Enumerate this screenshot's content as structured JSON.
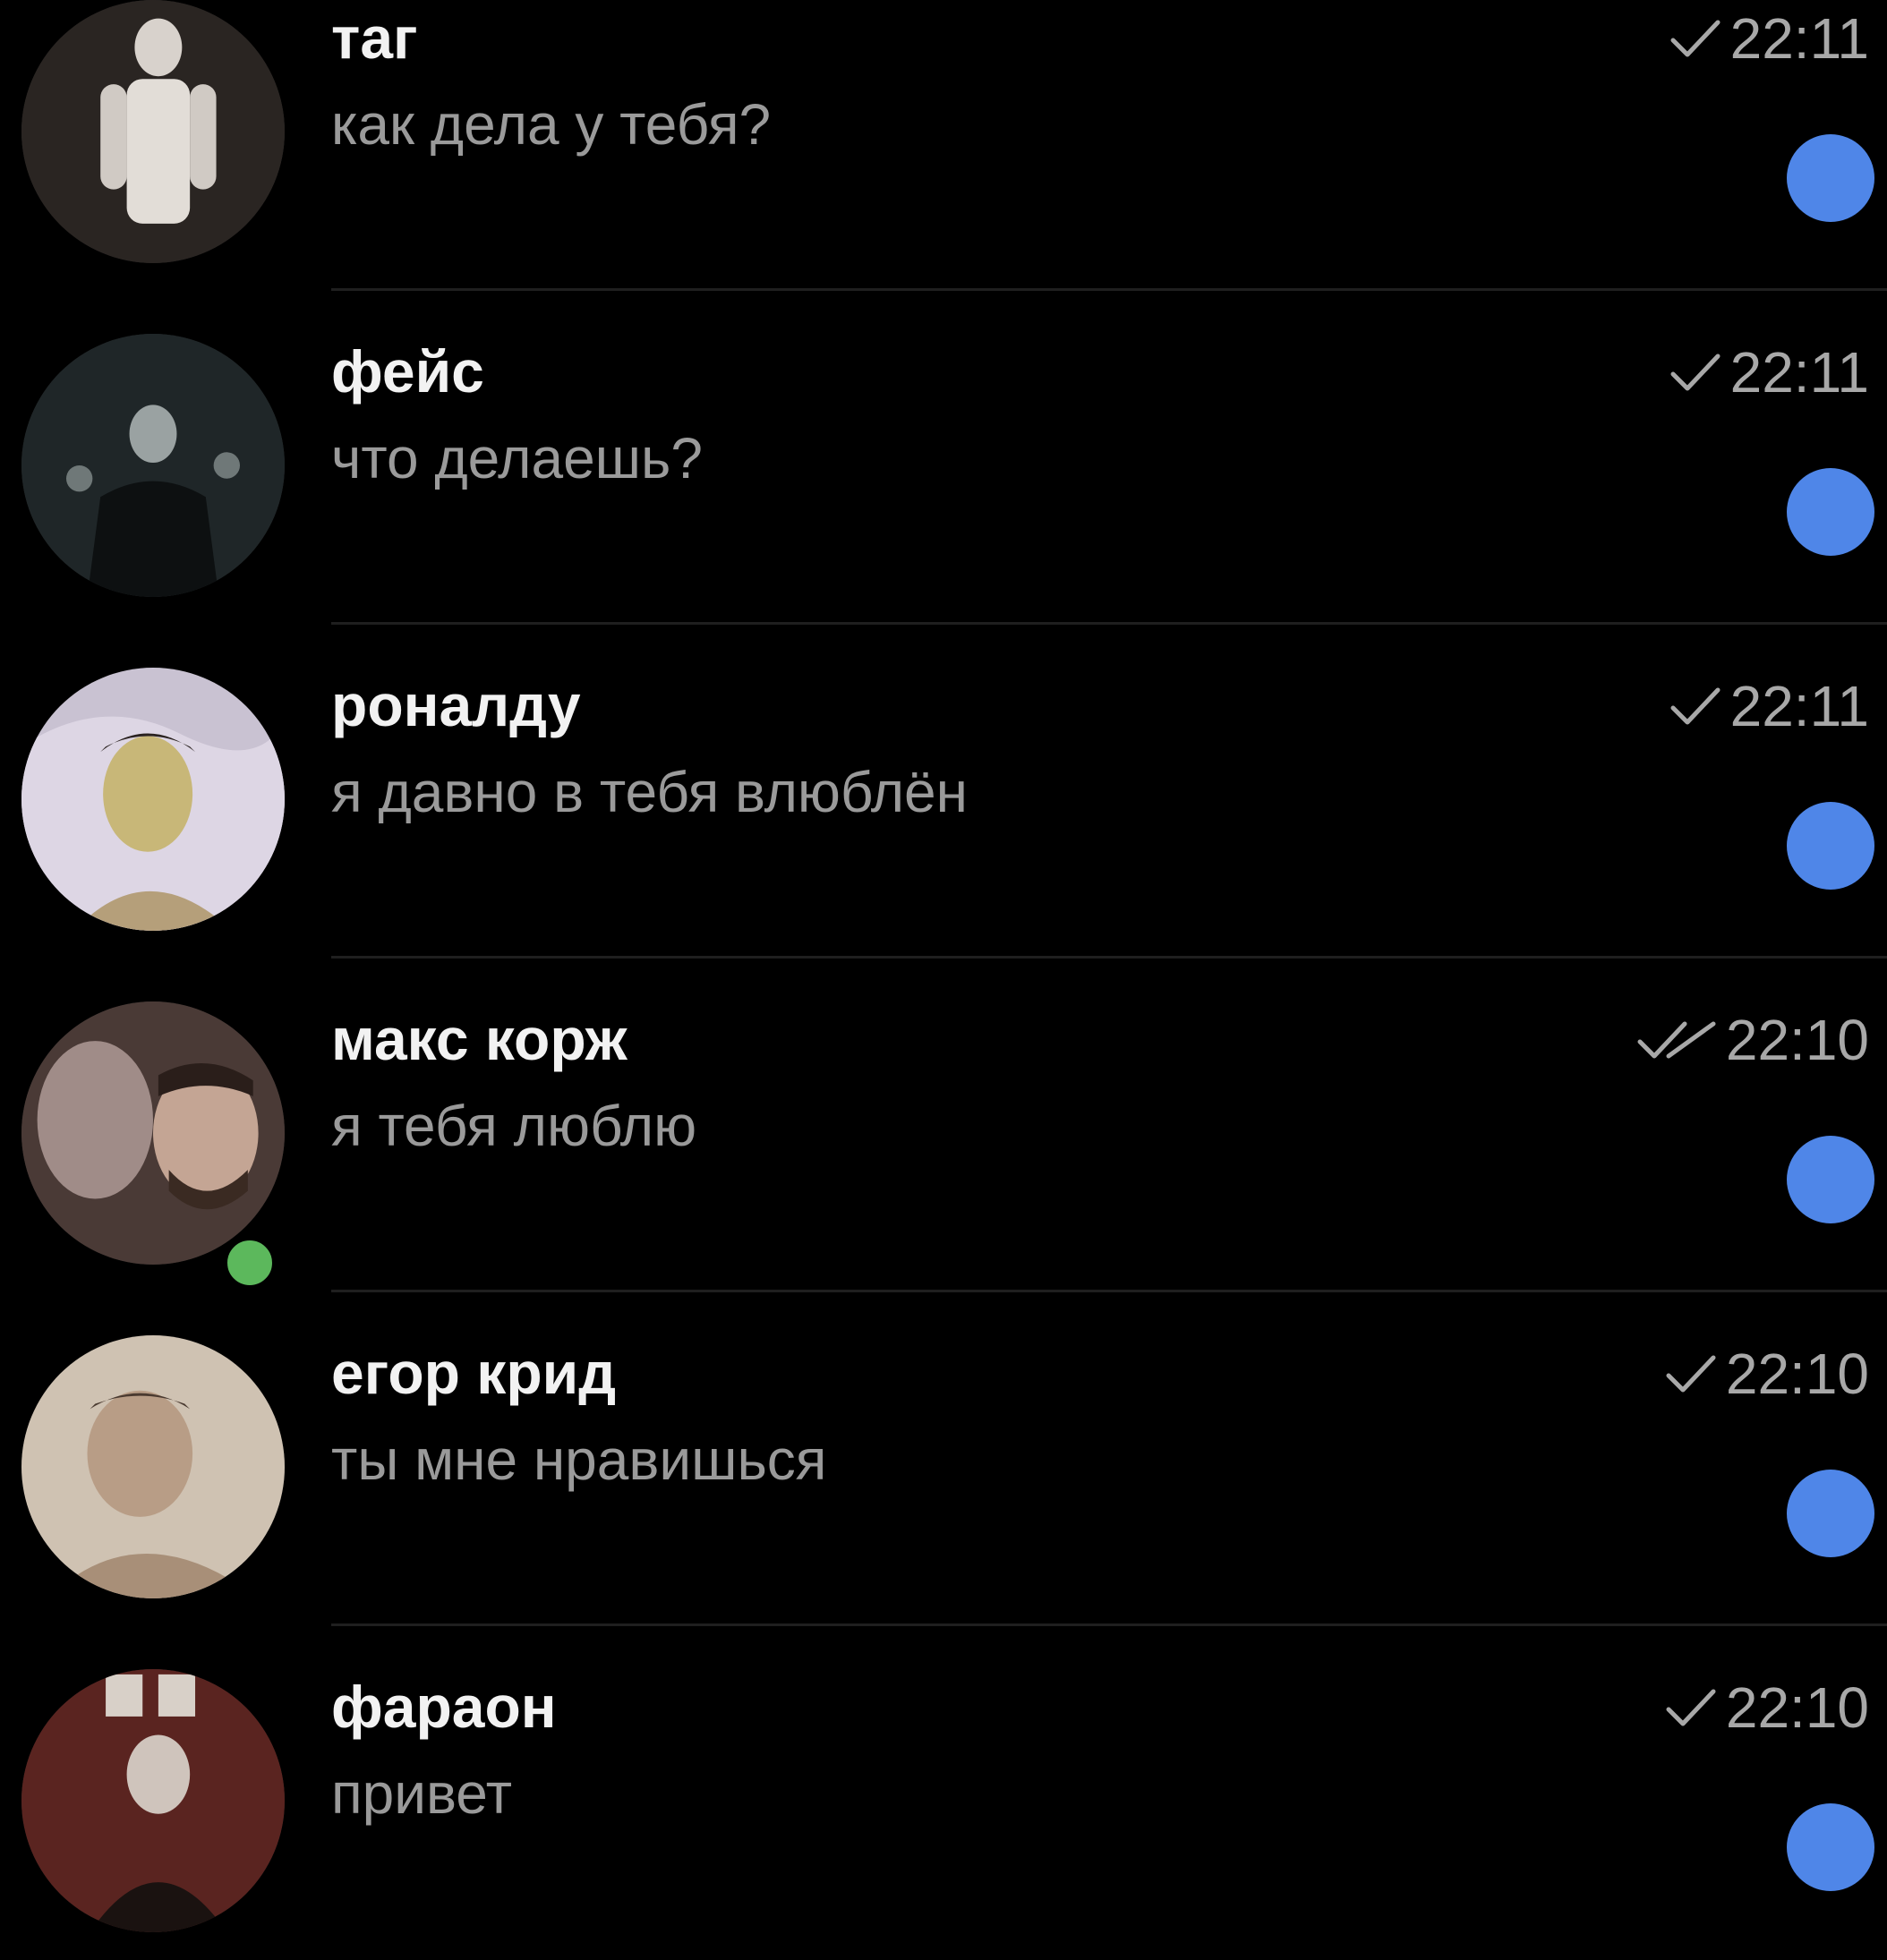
{
  "colors": {
    "background": "#000000",
    "name_text": "#f2f2f2",
    "preview_text": "#9a9a9a",
    "time_text": "#a8a8a8",
    "unread_dot": "#4f86e8",
    "online_dot": "#5cb85c"
  },
  "chats": [
    {
      "name": "таг",
      "preview": "как дела у тебя?",
      "time": "22:11",
      "status": "sent-check-icon",
      "unread": true,
      "online": false
    },
    {
      "name": "фейс",
      "preview": "что делаешь?",
      "time": "22:11",
      "status": "sent-check-icon",
      "unread": true,
      "online": false
    },
    {
      "name": "роналду",
      "preview": "я давно в тебя влюблён",
      "time": "22:11",
      "status": "sent-check-icon",
      "unread": true,
      "online": false
    },
    {
      "name": "макс корж",
      "preview": "я тебя люблю",
      "time": "22:10",
      "status": "read-double-check-icon",
      "unread": true,
      "online": true
    },
    {
      "name": "егор крид",
      "preview": "ты мне нравишься",
      "time": "22:10",
      "status": "sent-check-icon",
      "unread": true,
      "online": false
    },
    {
      "name": "фараон",
      "preview": "привет",
      "time": "22:10",
      "status": "sent-check-icon",
      "unread": true,
      "online": false
    }
  ]
}
